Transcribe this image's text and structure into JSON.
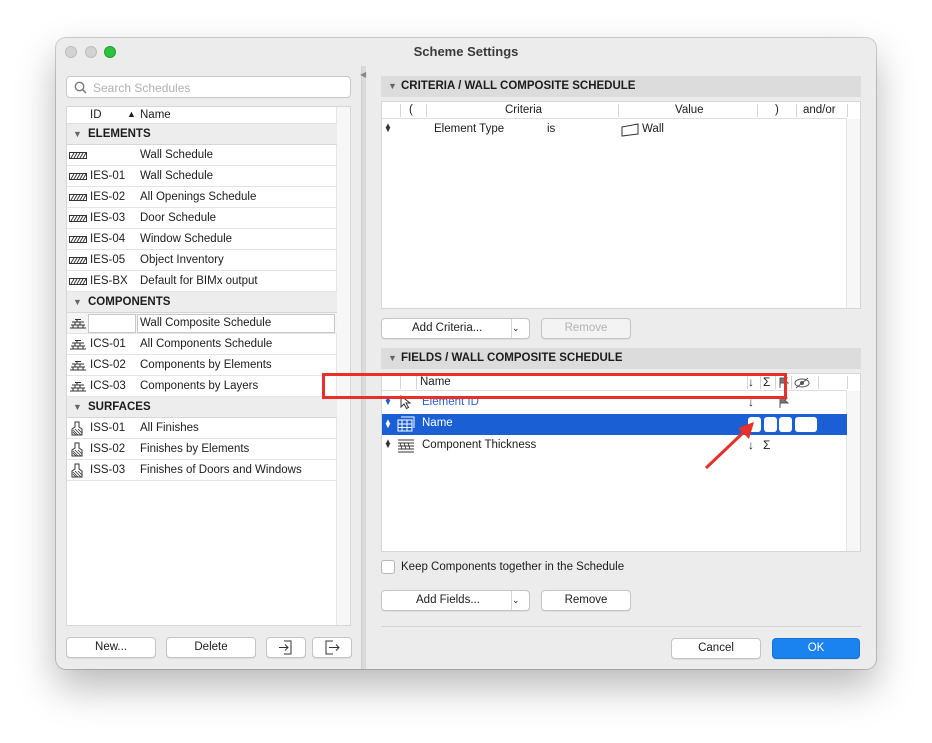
{
  "window": {
    "title": "Scheme Settings"
  },
  "left": {
    "search_placeholder": "Search Schedules",
    "header_id": "ID",
    "header_name": "Name",
    "groups": [
      {
        "label": "ELEMENTS",
        "rows": [
          {
            "id": "",
            "name": "Wall Schedule"
          },
          {
            "id": "IES-01",
            "name": "Wall Schedule"
          },
          {
            "id": "IES-02",
            "name": "All Openings Schedule"
          },
          {
            "id": "IES-03",
            "name": "Door Schedule"
          },
          {
            "id": "IES-04",
            "name": "Window Schedule"
          },
          {
            "id": "IES-05",
            "name": "Object Inventory"
          },
          {
            "id": "IES-BX",
            "name": "Default for BIMx output"
          }
        ]
      },
      {
        "label": "COMPONENTS",
        "rows": [
          {
            "id": "",
            "name": "Wall Composite Schedule"
          },
          {
            "id": "ICS-01",
            "name": "All Components Schedule"
          },
          {
            "id": "ICS-02",
            "name": "Components by Elements"
          },
          {
            "id": "ICS-03",
            "name": "Components by Layers"
          }
        ]
      },
      {
        "label": "SURFACES",
        "rows": [
          {
            "id": "ISS-01",
            "name": "All Finishes"
          },
          {
            "id": "ISS-02",
            "name": "Finishes by Elements"
          },
          {
            "id": "ISS-03",
            "name": "Finishes of Doors and Windows"
          }
        ]
      }
    ],
    "buttons": {
      "new": "New...",
      "delete": "Delete"
    }
  },
  "criteria": {
    "title": "CRITERIA /  WALL COMPOSITE SCHEDULE",
    "columns": {
      "open_paren": "(",
      "criteria": "Criteria",
      "value": "Value",
      "close_paren": ")",
      "andor": "and/or"
    },
    "rows": [
      {
        "criteria": "Element Type",
        "operator": "is",
        "value": "Wall"
      }
    ],
    "add_button": "Add Criteria...",
    "remove_button": "Remove"
  },
  "fields": {
    "title": "FIELDS /  WALL COMPOSITE SCHEDULE",
    "column_name": "Name",
    "rows": [
      {
        "name": "Element ID"
      },
      {
        "name": "Name"
      },
      {
        "name": "Component Thickness"
      }
    ],
    "keep_components_label": "Keep Components together in the Schedule",
    "add_button": "Add Fields...",
    "remove_button": "Remove"
  },
  "footer": {
    "cancel": "Cancel",
    "ok": "OK"
  },
  "colors": {
    "accent": "#1a83f0",
    "selection": "#1a5fd4",
    "annotation": "#e8302a"
  }
}
